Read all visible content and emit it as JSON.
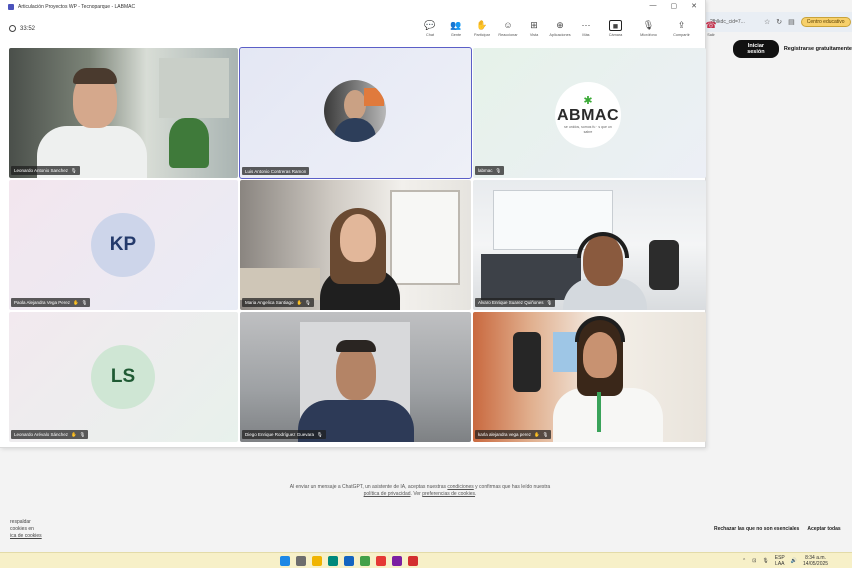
{
  "window": {
    "title": "Articulación Proyectos WP - Tecnoparque - LABMAC",
    "controls": [
      "—",
      "▢",
      "✕"
    ]
  },
  "meeting": {
    "timer": "33:52",
    "toolbar": [
      {
        "label": "Chat",
        "glyph": "💬"
      },
      {
        "label": "Gente",
        "glyph": "👥"
      },
      {
        "label": "Participar",
        "glyph": "✋"
      },
      {
        "label": "Reaccionar",
        "glyph": "☺"
      },
      {
        "label": "Vista",
        "glyph": "⊞"
      },
      {
        "label": "Aplicaciones",
        "glyph": "⊕"
      },
      {
        "label": "Más",
        "glyph": "⋯"
      },
      {
        "label": "Cámara",
        "glyph": "■"
      },
      {
        "label": "Micrófono",
        "glyph": "🎙"
      },
      {
        "label": "Compartir",
        "glyph": "⇪"
      },
      {
        "label": "Salir",
        "glyph": "☎"
      }
    ]
  },
  "participants": [
    {
      "name": "Leonardo Antonio Sanchez",
      "type": "video"
    },
    {
      "name": "Luis Antonio Contreras Ramon",
      "type": "video",
      "active": true
    },
    {
      "name": "labmac",
      "type": "logo",
      "logo_text": "ABMAC",
      "logo_subtext": "se unidos, somos fu · s que un sabre"
    },
    {
      "name": "Paola Alejandra Vega Perez",
      "type": "avatar",
      "initials": "KP"
    },
    {
      "name": "Maria Angelica Santiago",
      "type": "video"
    },
    {
      "name": "Alvaro Enrique Suarez Quiñones",
      "type": "video"
    },
    {
      "name": "Leonardo Arévalo Sánchez",
      "type": "avatar",
      "initials": "LS"
    },
    {
      "name": "Diego Enrique Rodríguez Guevara",
      "type": "video"
    },
    {
      "name": "karla alejandra vega perez",
      "type": "video"
    }
  ],
  "browser": {
    "url_fragment": "?fblkdc_cid=7...",
    "edu_badge": "Centro educativo",
    "login": "Iniciar sesión",
    "signup": "Registrarse gratuitamente"
  },
  "disclaimer": {
    "line1_pre": "Al enviar un mensaje a ChatGPT, un asistente de IA, aceptas nuestras",
    "link_terms": "condiciones",
    "line1_post": "y confirmas que has leído nuestra",
    "link_privacy": "política de privacidad",
    "mid": ". Ver",
    "link_cookies": "preferencias de cookies",
    "end": "."
  },
  "cookies": {
    "line1": "respaldar",
    "line2": "cookies en",
    "line3": "ica de cookies",
    "reject": "Rechazar las que no son esenciales",
    "accept": "Aceptar todas"
  },
  "taskbar": {
    "apps_colors": [
      "#1e88e5",
      "#6d6d6d",
      "#f0b400",
      "#00897b",
      "#1565c0",
      "#43a047",
      "#e53935",
      "#7b1fa2",
      "#d32f2f"
    ],
    "lang": "ESP",
    "lang2": "LAA",
    "time": "8:34 a.m.",
    "date": "14/05/2025"
  }
}
